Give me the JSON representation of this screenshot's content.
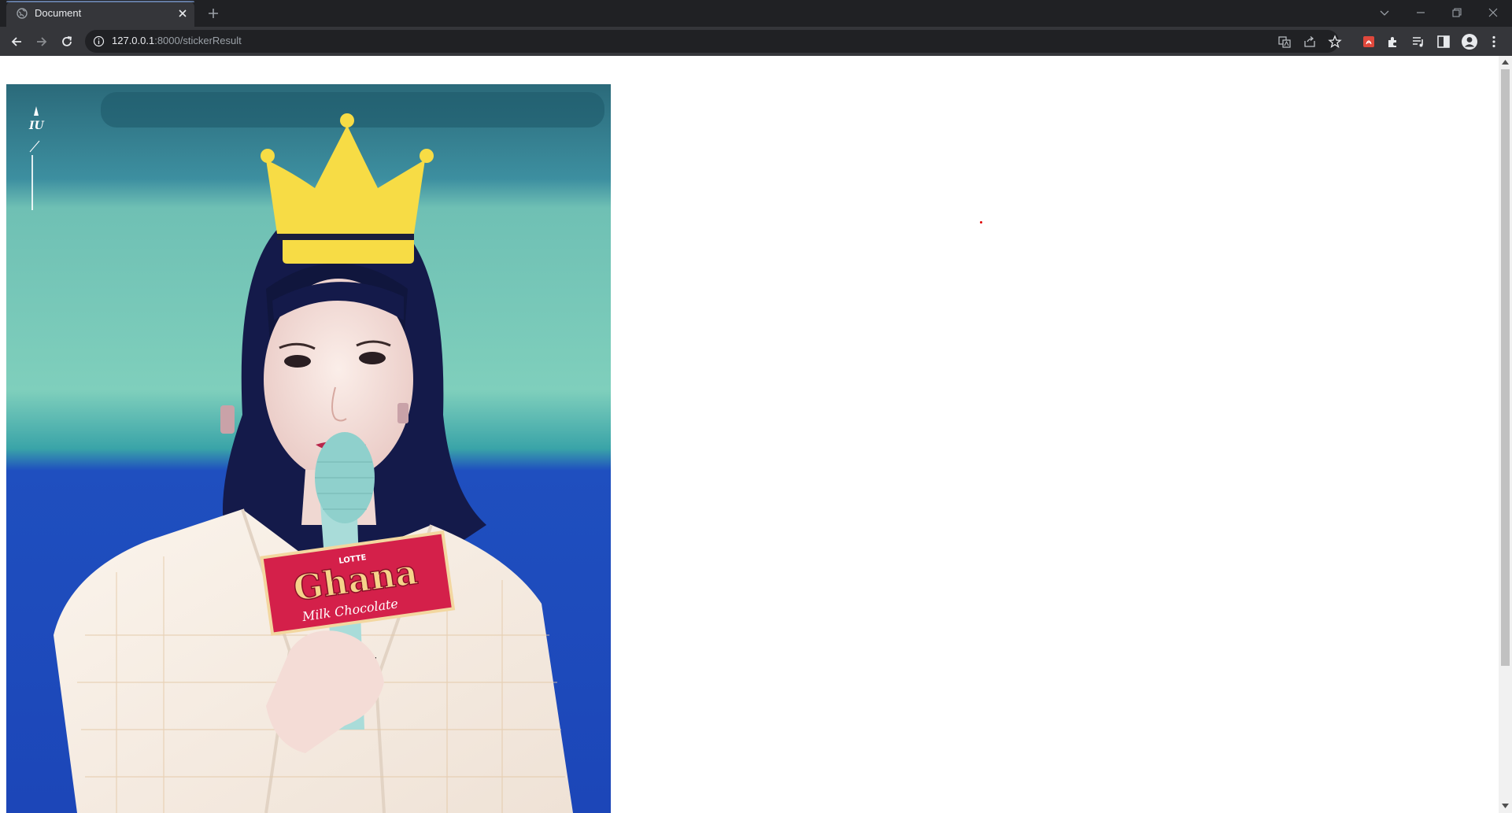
{
  "tab": {
    "title": "Document",
    "close_icon": "close-icon",
    "favicon": "globe-icon"
  },
  "new_tab": {
    "icon": "plus-icon"
  },
  "window_controls": [
    "chevron-down-icon",
    "minimize-icon",
    "restore-icon",
    "close-icon"
  ],
  "navigation": {
    "back": "arrow-left-icon",
    "forward": "arrow-right-icon",
    "reload": "reload-icon"
  },
  "address_bar": {
    "host": "127.0.0.1",
    "path": ":8000/stickerResult",
    "security_icon": "info-icon"
  },
  "omnibox_actions": [
    "translate-icon",
    "share-icon",
    "star-icon"
  ],
  "extensions": [
    "pdf-extension-icon",
    "puzzle-icon",
    "media-queue-icon",
    "side-panel-icon",
    "profile-avatar-icon",
    "more-vert-icon"
  ],
  "page": {
    "image": {
      "description_icon": "photo-with-sticker",
      "watermark_text": "IU",
      "candy_box": {
        "brand": "LOTTE",
        "title": "Ghana",
        "subtitle": "Milk Chocolate"
      },
      "sticker": "crown-sticker"
    }
  },
  "colors": {
    "tabbar_bg": "#202124",
    "toolbar_bg": "#35363a",
    "crown": "#f7dc45",
    "candy_red": "#d4204a",
    "dot": "#e00000"
  }
}
